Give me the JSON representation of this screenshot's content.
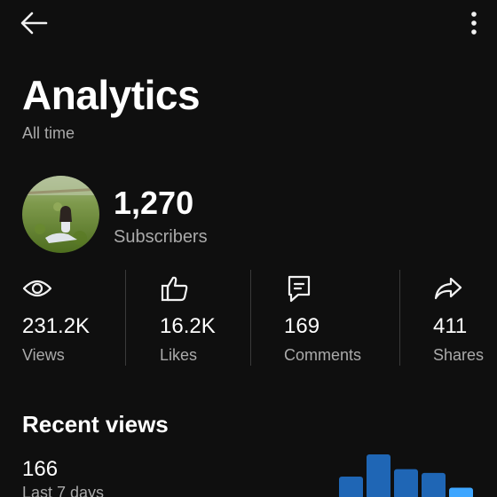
{
  "header": {
    "back_icon": "arrow-left-icon",
    "more_icon": "more-vert-icon"
  },
  "page": {
    "title": "Analytics",
    "subtitle": "All time"
  },
  "channel": {
    "subscribers_count": "1,270",
    "subscribers_label": "Subscribers"
  },
  "stats": [
    {
      "icon": "eye-icon",
      "value": "231.2K",
      "label": "Views"
    },
    {
      "icon": "thumbs-up-icon",
      "value": "16.2K",
      "label": "Likes"
    },
    {
      "icon": "comment-icon",
      "value": "169",
      "label": "Comments"
    },
    {
      "icon": "share-icon",
      "value": "411",
      "label": "Shares"
    }
  ],
  "recent": {
    "title": "Recent views",
    "value": "166",
    "label": "Last 7 days"
  },
  "colors": {
    "background": "#0f0f0f",
    "text_primary": "#ffffff",
    "text_secondary": "#aaaaaa",
    "bar_dark": "#1f66b5",
    "bar_light": "#3ea6ff"
  },
  "chart_data": {
    "type": "bar",
    "values": [
      3,
      6,
      4,
      3.5,
      1.5
    ]
  }
}
